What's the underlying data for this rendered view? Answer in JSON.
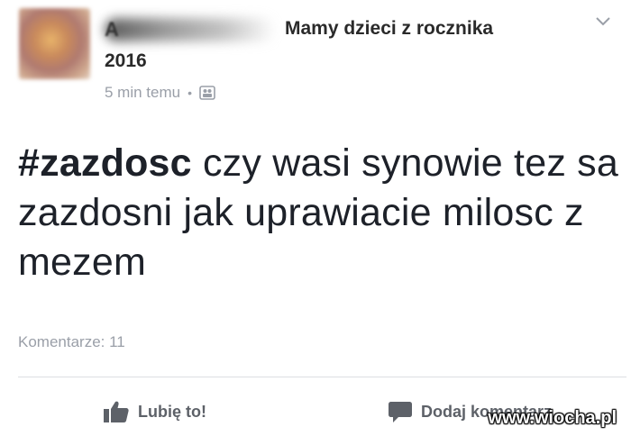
{
  "post": {
    "author_initial": "A",
    "group_name": "Mamy dzieci z rocznika",
    "group_year": "2016",
    "timestamp": "5 min temu",
    "separator": "•",
    "privacy_icon": "group-icon",
    "hashtag": "#zazdosc",
    "body": " czy wasi synowie tez sa zazdosni jak uprawiacie milosc z mezem",
    "comments_count": "Komentarze: 11"
  },
  "actions": {
    "like_label": "Lubię to!",
    "like_icon": "thumbs-up-icon",
    "comment_label": "Dodaj komentarz",
    "comment_icon": "speech-bubble-icon"
  },
  "watermark": "www.wiocha.pl",
  "colors": {
    "text": "#1d2129",
    "meta": "#9a9fa8",
    "action": "#5d6168"
  }
}
